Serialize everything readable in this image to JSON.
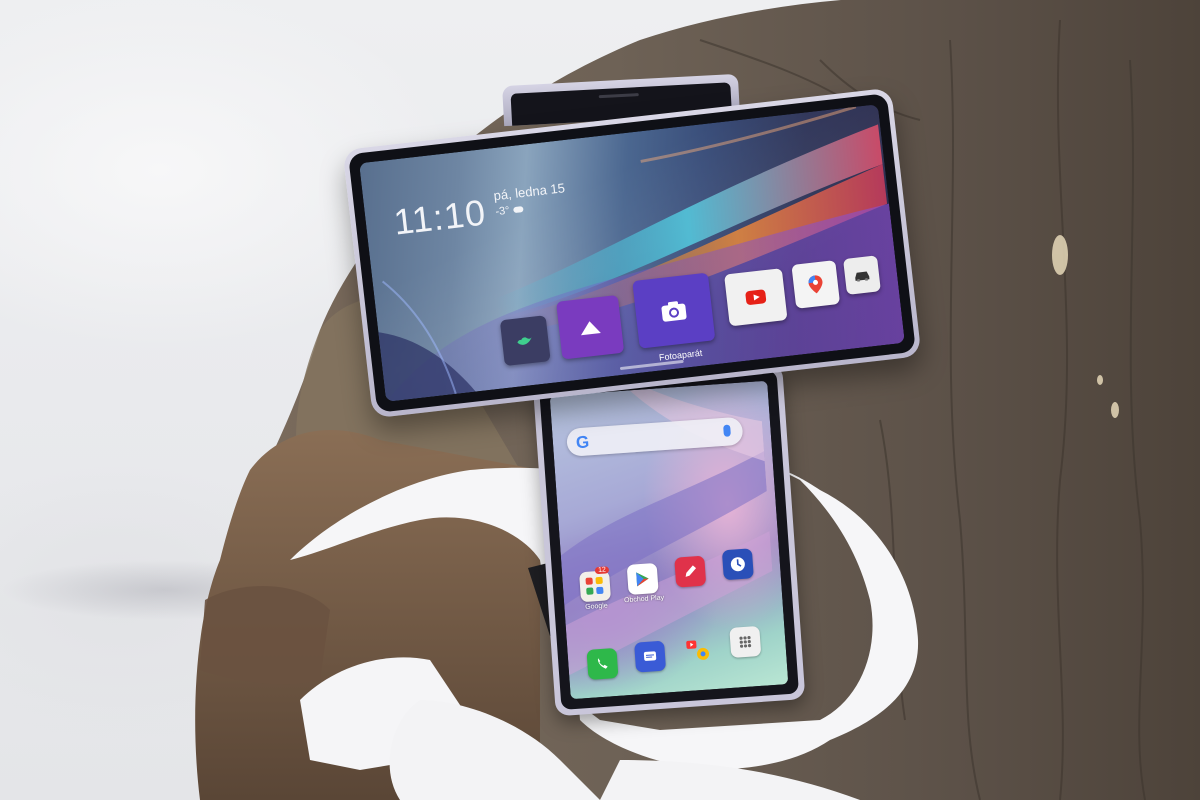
{
  "scene": {
    "description_free": true,
    "colors": {
      "snow": "#eeeff1",
      "bark": "#6e6256",
      "bark_dark": "#4d433a",
      "phone_frame": "#c9c6da",
      "stand": "#1e1e22"
    }
  },
  "top_screen": {
    "time": "11:10",
    "date": "pá, ledna 15",
    "temperature": "-3°",
    "weather_icon": "cloud-icon",
    "apps": [
      {
        "name": "twitter",
        "icon": "bird-icon",
        "color": "#3b3d63",
        "label": ""
      },
      {
        "name": "gallery",
        "icon": "mountain-icon",
        "color": "#7a3bbf",
        "label": ""
      },
      {
        "name": "camera",
        "icon": "camera-icon",
        "color": "#5b3fc4",
        "label": "Fotoaparát"
      },
      {
        "name": "youtube",
        "icon": "youtube-icon",
        "color": "#f1f1f1",
        "label": ""
      },
      {
        "name": "maps",
        "icon": "map-pin-icon",
        "color": "#f4f4f4",
        "label": ""
      },
      {
        "name": "car",
        "icon": "car-icon",
        "color": "#ededed",
        "label": ""
      }
    ]
  },
  "bottom_screen": {
    "search_logo": "G",
    "apps_row": [
      {
        "name": "google-folder",
        "icon": "folder-icon",
        "label": "Google",
        "badge": "12",
        "color": "#f2efe9"
      },
      {
        "name": "play-store",
        "icon": "play-store-icon",
        "label": "Obchod Play",
        "badge": "",
        "color": "#ffffff"
      },
      {
        "name": "notes",
        "icon": "pencil-icon",
        "label": "",
        "badge": "",
        "color": "#e0324a"
      },
      {
        "name": "clock",
        "icon": "clock-icon",
        "label": "",
        "badge": "",
        "color": "#2a4fb8"
      }
    ],
    "dock": [
      {
        "name": "phone",
        "icon": "phone-icon",
        "color": "#2eb84a"
      },
      {
        "name": "messages",
        "icon": "message-icon",
        "color": "#3a5bd6"
      },
      {
        "name": "chrome-youtube",
        "icon": "chrome-icon",
        "color": "#f3f3f3"
      },
      {
        "name": "app-drawer",
        "icon": "grid-icon",
        "color": "#f0f0f0"
      }
    ]
  }
}
